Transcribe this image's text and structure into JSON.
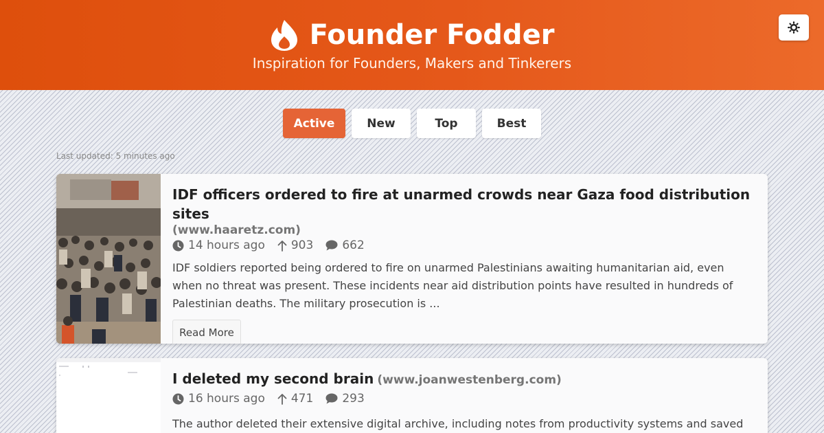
{
  "header": {
    "title": "Founder Fodder",
    "tagline": "Inspiration for Founders, Makers and Tinkerers",
    "logo_icon": "flame-icon",
    "theme_toggle_icon": "sun-icon"
  },
  "tabs": [
    {
      "label": "Active",
      "active": true
    },
    {
      "label": "New",
      "active": false
    },
    {
      "label": "Top",
      "active": false
    },
    {
      "label": "Best",
      "active": false
    }
  ],
  "last_updated": "Last updated: 5 minutes ago",
  "stories": [
    {
      "title": "IDF officers ordered to fire at unarmed crowds near Gaza food distribution sites",
      "domain": "(www.haaretz.com)",
      "age": "14 hours ago",
      "points": "903",
      "comments": "662",
      "summary": "IDF soldiers reported being ordered to fire on unarmed Palestinians awaiting humanitarian aid, even when no threat was present. These incidents near aid distribution points have resulted in hundreds of Palestinian deaths. The military prosecution is ...",
      "read_more": "Read More"
    },
    {
      "title": "I deleted my second brain",
      "domain": "(www.joanwestenberg.com)",
      "age": "16 hours ago",
      "points": "471",
      "comments": "293",
      "summary": "The author deleted their extensive digital archive, including notes from productivity systems and saved ideas,"
    }
  ],
  "colors": {
    "header_start": "#de4f0c",
    "header_end": "#ec6a2a",
    "active_tab": "#e56436"
  }
}
